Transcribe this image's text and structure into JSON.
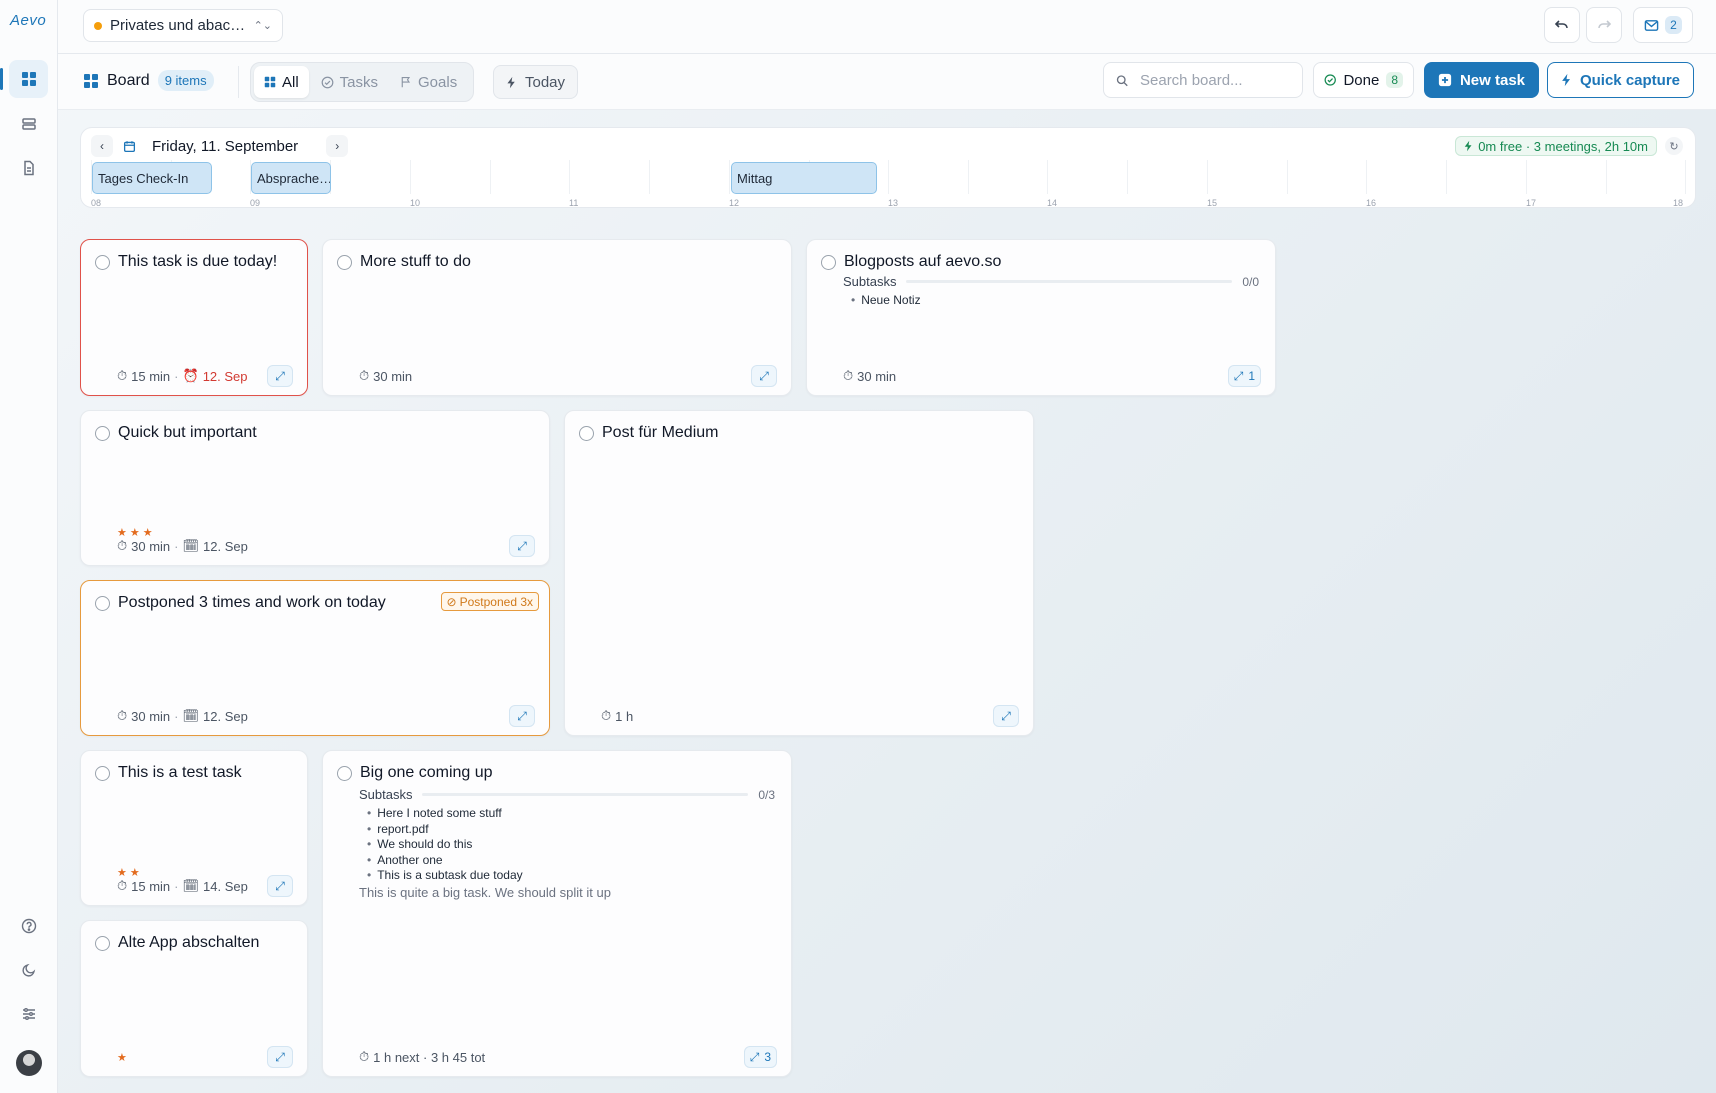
{
  "app": {
    "logo": "Aevo"
  },
  "topbar": {
    "workspace": "Privates und abac…",
    "mail_count": "2"
  },
  "toolbar": {
    "board_label": "Board",
    "items_count": "9 items",
    "filters": {
      "all": "All",
      "tasks": "Tasks",
      "goals": "Goals"
    },
    "today_label": "Today",
    "search_placeholder": "Search board...",
    "done_label": "Done",
    "done_count": "8",
    "new_task_label": "New task",
    "quick_capture_label": "Quick capture"
  },
  "timeline": {
    "date": "Friday, 11. September",
    "status": "0m free · 3 meetings, 2h 10m",
    "hours": [
      "08",
      "09",
      "10",
      "11",
      "12",
      "13",
      "14",
      "15",
      "16",
      "17",
      "18"
    ],
    "events": [
      {
        "label": "Tages Check-In"
      },
      {
        "label": "Absprache…"
      },
      {
        "label": "Mittag"
      }
    ]
  },
  "cards": [
    {
      "title": "This task is due today!",
      "duration": "15 min",
      "due": "12. Sep"
    },
    {
      "title": "More stuff to do",
      "duration": "30 min"
    },
    {
      "title": "Blogposts auf aevo.so",
      "subtasks_label": "Subtasks",
      "ratio": "0/0",
      "items": [
        "Neue Notiz"
      ],
      "duration": "30 min",
      "expand_count": "1"
    },
    {
      "title": "Quick but important",
      "stars": "★★★",
      "duration": "30 min",
      "date": "12. Sep"
    },
    {
      "title": "Post für Medium",
      "duration": "1 h"
    },
    {
      "title": "Postponed 3 times and work on today",
      "badge": "Postponed 3x",
      "duration": "30 min",
      "date": "12. Sep"
    },
    {
      "title": "This is a test task",
      "stars": "★★",
      "duration": "15 min",
      "date": "14. Sep"
    },
    {
      "title": "Big one coming up",
      "subtasks_label": "Subtasks",
      "ratio": "0/3",
      "items": [
        "Here I noted some stuff",
        "report.pdf",
        "We should do this",
        "Another one",
        "This is a subtask due today"
      ],
      "note": "This is quite a big task. We should split it up",
      "duration": "1 h next · 3 h 45 tot",
      "expand_count": "3"
    },
    {
      "title": "Alte App abschalten",
      "stars": "★"
    }
  ],
  "colors": {
    "accent": "#1d76b8",
    "overdue": "#e0524a",
    "postponed": "#e69a3e",
    "stars": "#e36b1e"
  }
}
